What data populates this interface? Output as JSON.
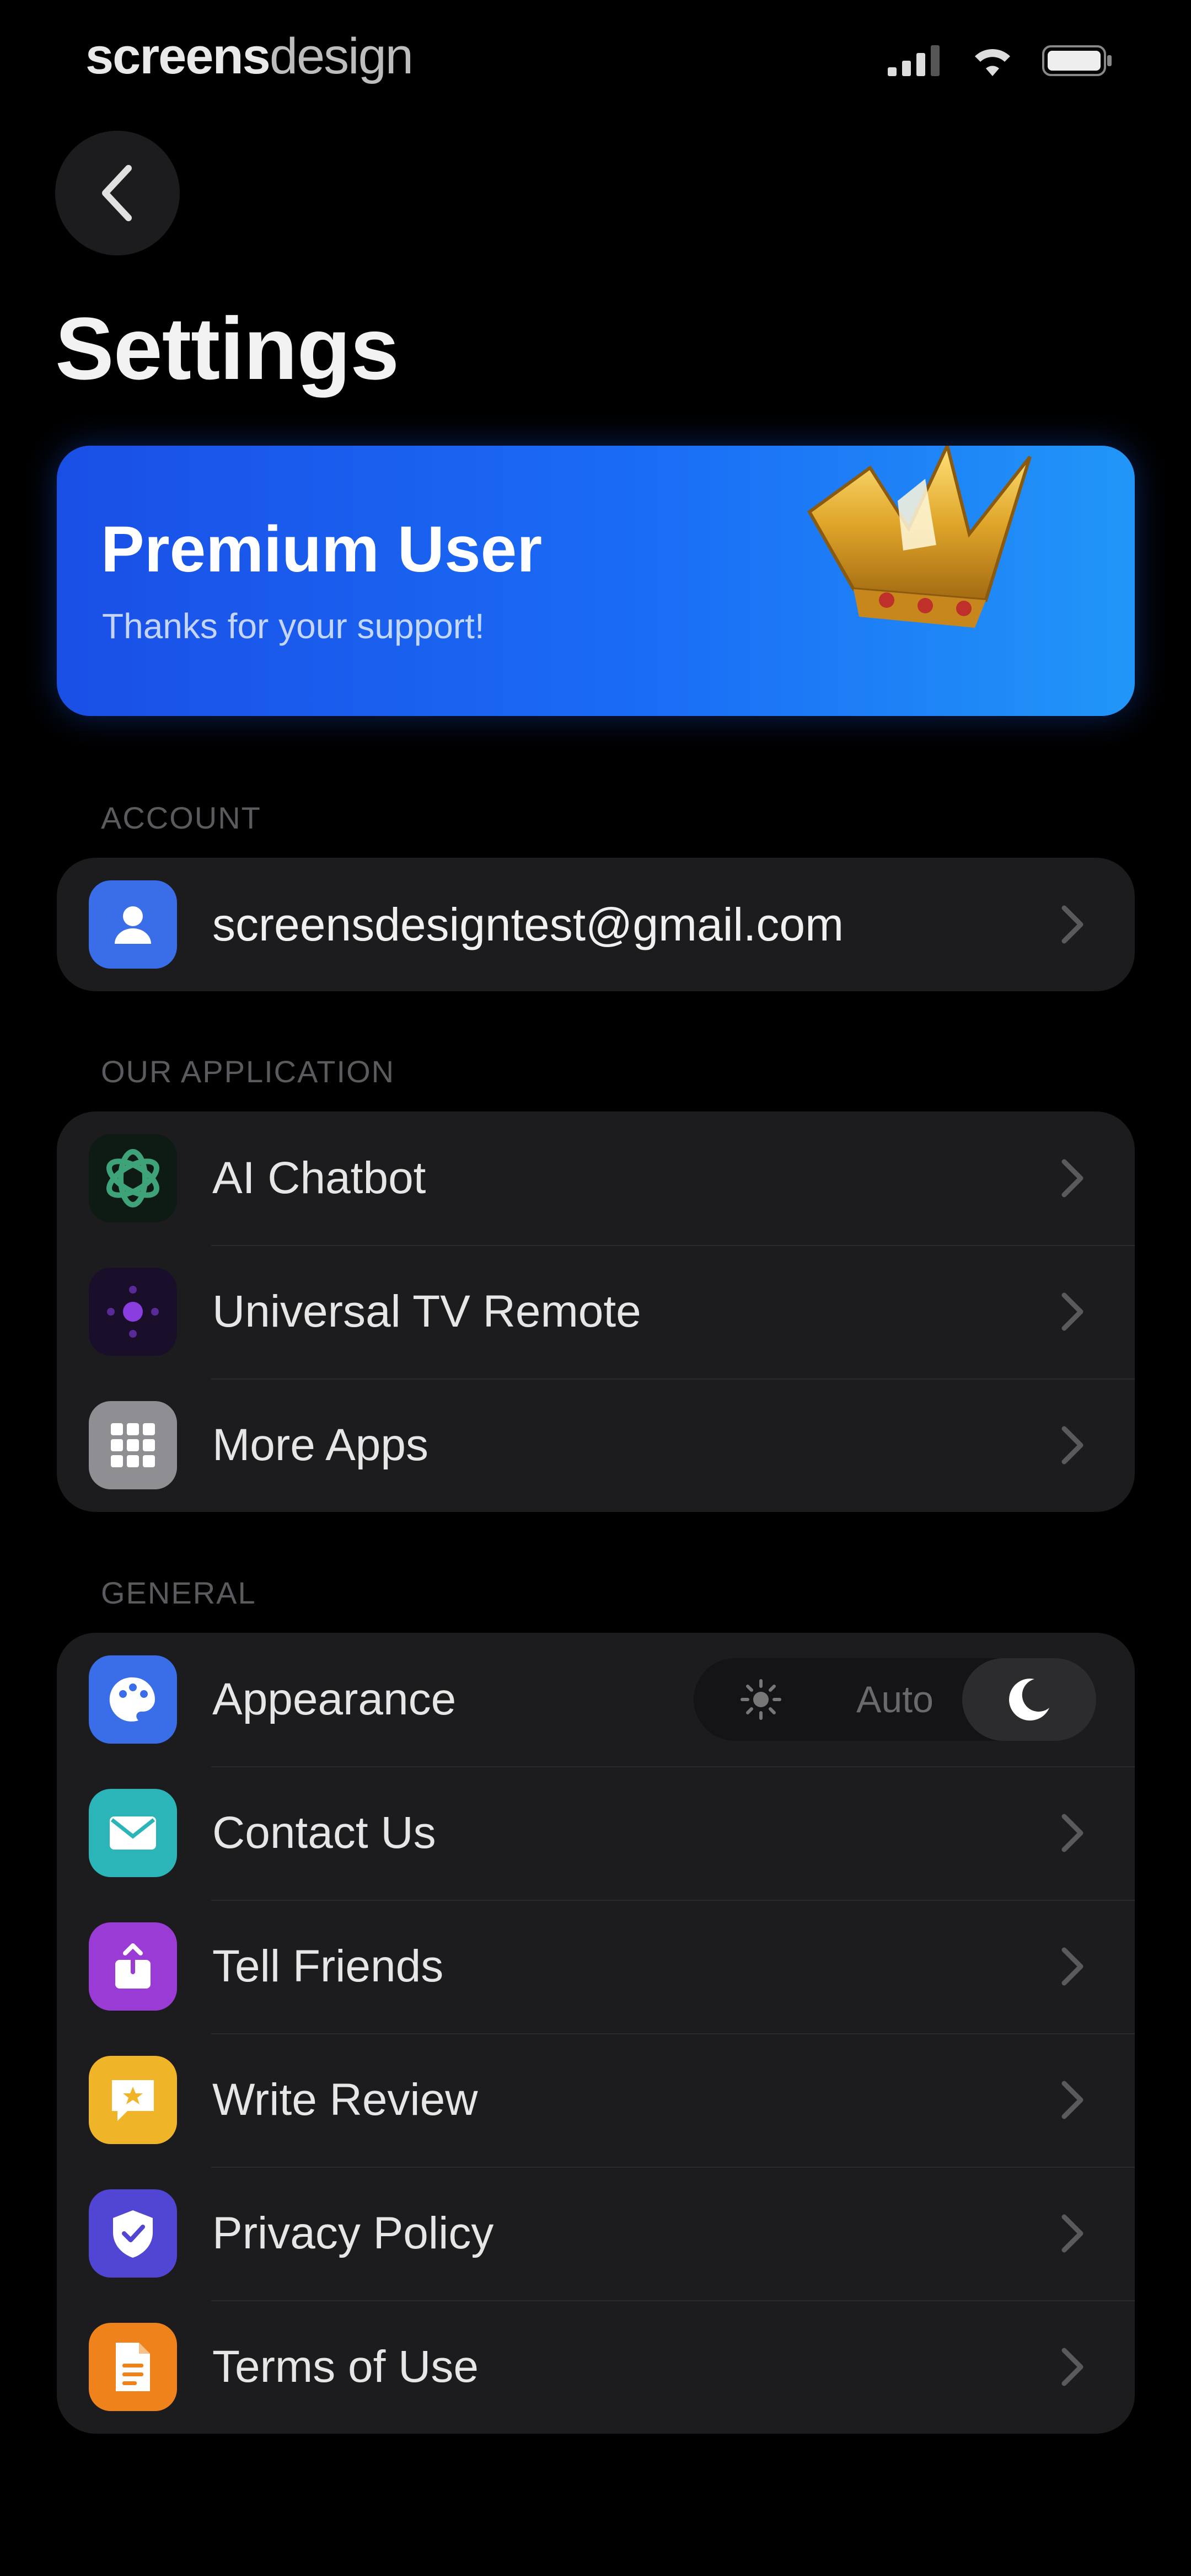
{
  "status_bar": {
    "brand_bold": "screens",
    "brand_light": "design"
  },
  "header": {
    "title": "Settings"
  },
  "premium": {
    "title": "Premium User",
    "subtitle": "Thanks for your support!"
  },
  "sections": {
    "account": {
      "header": "ACCOUNT",
      "email": "screensdesigntest@gmail.com"
    },
    "application": {
      "header": "OUR APPLICATION",
      "items": [
        {
          "label": "AI Chatbot",
          "icon": "chatgpt-icon",
          "color": "#0e1a14"
        },
        {
          "label": "Universal TV Remote",
          "icon": "remote-icon",
          "color": "#1a0f2a"
        },
        {
          "label": "More Apps",
          "icon": "grid-icon",
          "color": "#8e8e93"
        }
      ]
    },
    "general": {
      "header": "GENERAL",
      "appearance": {
        "label": "Appearance",
        "options": [
          "sun",
          "Auto",
          "moon"
        ],
        "selected": "moon"
      },
      "items": [
        {
          "label": "Contact Us",
          "icon": "mail-icon",
          "color": "#2bb5b9"
        },
        {
          "label": "Tell Friends",
          "icon": "share-icon",
          "color": "#9b3bd6"
        },
        {
          "label": "Write Review",
          "icon": "review-icon",
          "color": "#f0b428"
        },
        {
          "label": "Privacy Policy",
          "icon": "shield-icon",
          "color": "#5145d4"
        },
        {
          "label": "Terms of Use",
          "icon": "document-icon",
          "color": "#f0821c"
        }
      ]
    }
  },
  "colors": {
    "background": "#000000",
    "group_bg": "#1c1c1e",
    "premium_gradient_start": "#1a4fe6",
    "premium_gradient_end": "#2196f8",
    "account_icon": "#3a6ee8",
    "appearance_icon": "#3a6ee8"
  }
}
